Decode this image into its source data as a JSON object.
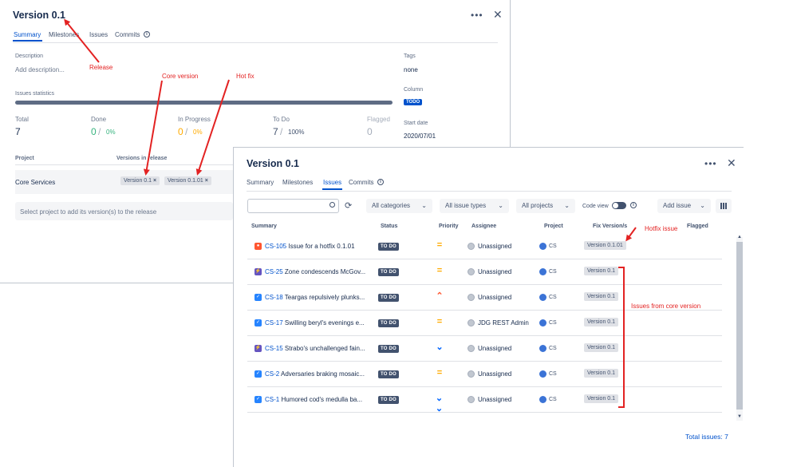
{
  "back": {
    "title": "Version 0.1",
    "tabs": [
      "Summary",
      "Milestones",
      "Issues",
      "Commits"
    ],
    "description_label": "Description",
    "description_placeholder": "Add description...",
    "tags_label": "Tags",
    "tags_value": "none",
    "column_label": "Column",
    "column_value": "TODO",
    "start_date_label": "Start date",
    "start_date_value": "2020/07/01",
    "issues_statistics_label": "Issues statistics",
    "stats": {
      "total_label": "Total",
      "total_value": "7",
      "done_label": "Done",
      "done_value": "0",
      "done_pct": "0%",
      "inprogress_label": "In Progress",
      "inprogress_value": "0",
      "inprogress_pct": "0%",
      "todo_label": "To Do",
      "todo_value": "7",
      "todo_pct": "100%",
      "flagged_label": "Flagged",
      "flagged_value": "0"
    },
    "project_header": "Project",
    "versions_header": "Versions in release",
    "project_name": "Core Services",
    "versions": [
      "Version 0.1",
      "Version 0.1.01"
    ],
    "select_placeholder": "Select project to add its version(s) to the release"
  },
  "front": {
    "title": "Version 0.1",
    "tabs": [
      "Summary",
      "Milestones",
      "Issues",
      "Commits"
    ],
    "filters": {
      "categories": "All categories",
      "issue_types": "All issue types",
      "projects": "All projects",
      "code_view": "Code view",
      "add_issue": "Add issue"
    },
    "headers": {
      "summary": "Summary",
      "status": "Status",
      "priority": "Priority",
      "assignee": "Assignee",
      "project": "Project",
      "fix_version": "Fix Version/s",
      "flagged": "Flagged"
    },
    "issues": [
      {
        "key": "CS-105",
        "summary": "Issue for a hotfix 0.1.01",
        "type": "bug",
        "status": "TO DO",
        "priority": "medium",
        "assignee": "Unassigned",
        "project": "CS",
        "fix": "Version 0.1.01"
      },
      {
        "key": "CS-25",
        "summary": "Zone condescends McGov...",
        "type": "epic",
        "status": "TO DO",
        "priority": "medium",
        "assignee": "Unassigned",
        "project": "CS",
        "fix": "Version 0.1"
      },
      {
        "key": "CS-18",
        "summary": "Teargas repulsively plunks...",
        "type": "task",
        "status": "TO DO",
        "priority": "high",
        "assignee": "Unassigned",
        "project": "CS",
        "fix": "Version 0.1"
      },
      {
        "key": "CS-17",
        "summary": "Swilling beryl's evenings e...",
        "type": "task",
        "status": "TO DO",
        "priority": "medium",
        "assignee": "JDG REST Admin",
        "project": "CS",
        "fix": "Version 0.1"
      },
      {
        "key": "CS-15",
        "summary": "Strabo's unchallenged fain...",
        "type": "epic",
        "status": "TO DO",
        "priority": "low",
        "assignee": "Unassigned",
        "project": "CS",
        "fix": "Version 0.1"
      },
      {
        "key": "CS-2",
        "summary": "Adversaries braking mosaic...",
        "type": "task",
        "status": "TO DO",
        "priority": "medium",
        "assignee": "Unassigned",
        "project": "CS",
        "fix": "Version 0.1"
      },
      {
        "key": "CS-1",
        "summary": "Humored cod's medulla ba...",
        "type": "task",
        "status": "TO DO",
        "priority": "lowest",
        "assignee": "Unassigned",
        "project": "CS",
        "fix": "Version 0.1"
      }
    ],
    "total": "Total issues: 7"
  },
  "annotations": {
    "release": "Release",
    "core_version": "Core version",
    "hot_fix": "Hot fix",
    "hotfix_issue": "Hotfix issue",
    "issues_from_core": "Issues from core version"
  },
  "colors": {
    "accent": "#0052cc",
    "done_green": "#36b37e",
    "inprogress_yellow": "#ffab00",
    "annotation_red": "#e32222",
    "bar": "#5e6c84"
  }
}
